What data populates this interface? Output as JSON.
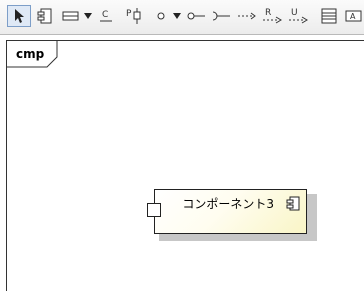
{
  "toolbar": {
    "buttons": [
      {
        "name": "select-tool-button",
        "letter": ""
      },
      {
        "name": "component-tool-button",
        "letter": ""
      },
      {
        "name": "class-tool-button",
        "letter": ""
      },
      {
        "name": "class-dropdown-button",
        "letter": ""
      },
      {
        "name": "collaboration-tool-button",
        "letter": "C"
      },
      {
        "name": "port-tool-button",
        "letter": "P"
      },
      {
        "name": "interface-tool-button",
        "letter": ""
      },
      {
        "name": "interface-dropdown-button",
        "letter": ""
      },
      {
        "name": "provided-interface-tool-button",
        "letter": ""
      },
      {
        "name": "required-interface-tool-button",
        "letter": ""
      },
      {
        "name": "dependency-tool-button",
        "letter": ""
      },
      {
        "name": "realization-tool-button",
        "letter": "R"
      },
      {
        "name": "usage-tool-button",
        "letter": "U"
      },
      {
        "name": "partition-tool-button",
        "letter": ""
      },
      {
        "name": "text-tool-button",
        "letter": "A"
      }
    ],
    "collab_letter": "C",
    "port_letter": "P",
    "realization_letter": "R",
    "usage_letter": "U",
    "text_letter": "A"
  },
  "diagram": {
    "frame_label": "cmp",
    "component_name": "コンポーネント3",
    "component_fill": "#fffde0",
    "component_border": "#222222",
    "selection_color": "#dfe9f6"
  }
}
